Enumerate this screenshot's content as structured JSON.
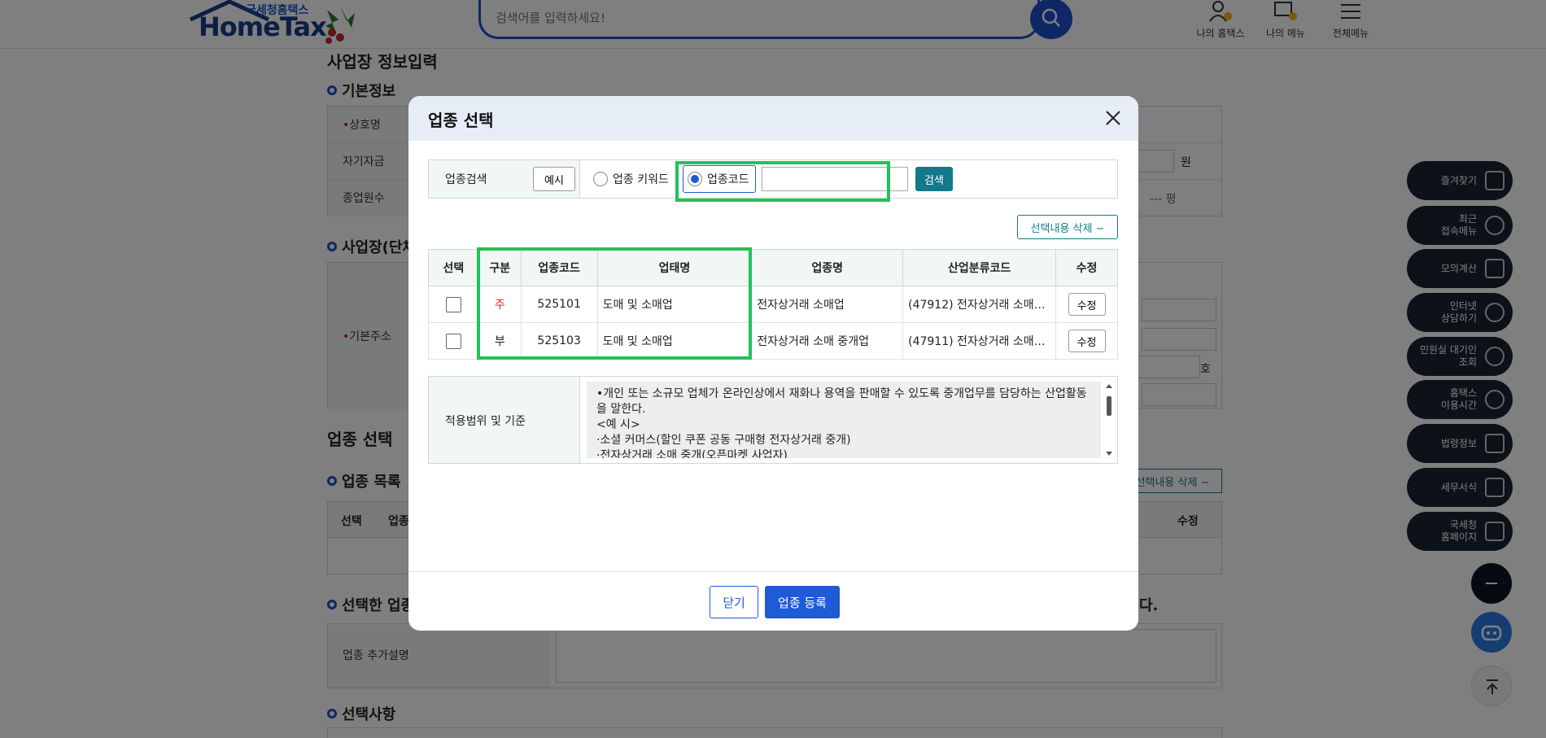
{
  "header": {
    "logo_small": "국세청홈택스",
    "logo_big": "HomeTax",
    "search_placeholder": "검색어를 입력하세요!",
    "links": [
      "나의 홈택스",
      "나의 메뉴",
      "전체메뉴"
    ]
  },
  "page": {
    "title": "사업장 정보입력",
    "basic_section": "기본정보",
    "rows": [
      "상호명",
      "자기자금",
      "종업원수"
    ],
    "unit_won": "원",
    "unit_pyeong": "--- 평",
    "biz_section": "사업장(단체",
    "address_label": "기본주소",
    "unit_ho": "호",
    "industry_title": "업종 선택",
    "industry_list": "업종 목록",
    "list_delete": "선택내용 삭제",
    "list_cols": [
      "선택",
      "업종",
      "수정"
    ],
    "selected_section": "선택한 업종",
    "selected_suffix": "다.",
    "extra_desc_label": "업종 추가설명",
    "choices_section": "선택사항"
  },
  "side_menu": [
    {
      "label": "즐겨찾기"
    },
    {
      "label": "최근\n접속메뉴"
    },
    {
      "label": "모의계산"
    },
    {
      "label": "인터넷\n상담하기"
    },
    {
      "label": "민원실 대기인\n조회"
    },
    {
      "label": "홈택스\n이용시간"
    },
    {
      "label": "법령정보"
    },
    {
      "label": "세무서식"
    },
    {
      "label": "국세청\n홈페이지"
    }
  ],
  "modal": {
    "title": "업종 선택",
    "search_label": "업종검색",
    "example_btn": "예시",
    "radio_keyword": "업종 키워드",
    "radio_code": "업종코드",
    "search_btn": "검색",
    "delete_btn": "선택내용 삭제",
    "columns": [
      "선택",
      "구분",
      "업종코드",
      "업태명",
      "업종명",
      "산업분류코드",
      "수정"
    ],
    "rows": [
      {
        "type": "주",
        "code": "525101",
        "biz": "도매 및 소매업",
        "name": "전자상거래 소매업",
        "ksic": "(47912) 전자상거래 소매…",
        "edit": "수정"
      },
      {
        "type": "부",
        "code": "525103",
        "biz": "도매 및 소매업",
        "name": "전자상거래 소매 중개업",
        "ksic": "(47911) 전자상거래 소매…",
        "edit": "수정"
      }
    ],
    "scope_label": "적용범위 및 기준",
    "scope_lines": [
      "•개인 또는 소규모 업체가 온라인상에서 재화나 용역을 판매할 수 있도록  중개업무를 담당하는 산업활동을 말한다.",
      "<예 시>",
      "·소셜 커머스(할인 쿠폰 공동 구매형 전자상거래 중개)",
      "·전자상거래 소매 중개(오픈마켓 사업자)"
    ],
    "close_btn": "닫기",
    "register_btn": "업종 등록"
  },
  "colors": {
    "accent": "#1e5bd4",
    "teal": "#127a8c",
    "highlight": "#20c35a",
    "main_type": "#e02020"
  }
}
